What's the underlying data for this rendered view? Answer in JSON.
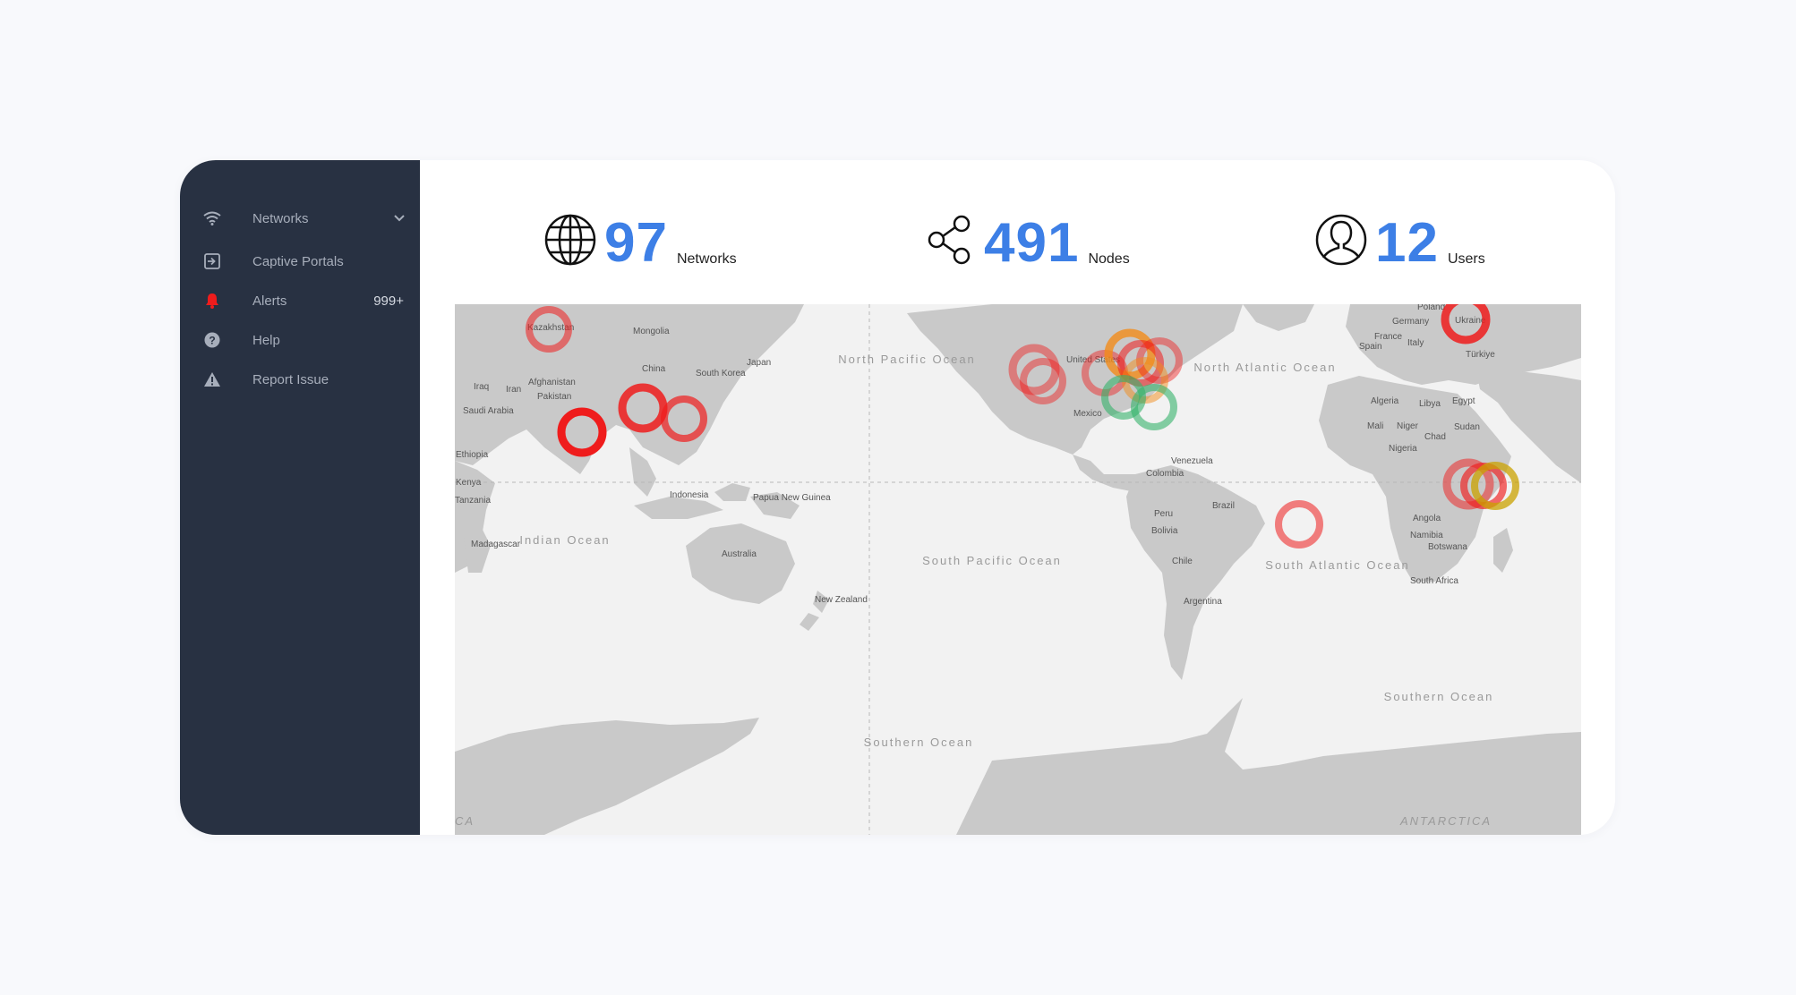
{
  "sidebar": {
    "items": [
      {
        "label": "Networks",
        "icon": "wifi-icon"
      },
      {
        "label": "Captive Portals",
        "icon": "portal-icon"
      },
      {
        "label": "Alerts",
        "icon": "bell-icon",
        "badge": "999+"
      },
      {
        "label": "Help",
        "icon": "help-icon"
      },
      {
        "label": "Report Issue",
        "icon": "warning-icon"
      }
    ]
  },
  "stats": {
    "networks": {
      "value": "97",
      "label": "Networks",
      "icon": "globe-icon"
    },
    "nodes": {
      "value": "491",
      "label": "Nodes",
      "icon": "share-icon"
    },
    "users": {
      "value": "12",
      "label": "Users",
      "icon": "user-icon"
    }
  },
  "map": {
    "country_labels": [
      "Kazakhstan",
      "Mongolia",
      "China",
      "South Korea",
      "Japan",
      "Afghanistan",
      "Iran",
      "Iraq",
      "Pakistan",
      "Saudi Arabia",
      "Ethiopia",
      "Kenya",
      "Tanzania",
      "Madagascar",
      "Indonesia",
      "Papua New Guinea",
      "Australia",
      "New Zealand",
      "United States",
      "Mexico",
      "Venezuela",
      "Colombia",
      "Peru",
      "Brazil",
      "Bolivia",
      "Chile",
      "Argentina",
      "Poland",
      "Ukraine",
      "Germany",
      "France",
      "Spain",
      "Italy",
      "Türkiye",
      "Algeria",
      "Libya",
      "Egypt",
      "Mali",
      "Niger",
      "Chad",
      "Sudan",
      "Nigeria",
      "Angola",
      "Namibia",
      "Botswana",
      "South Africa"
    ],
    "ocean_labels": [
      "Indian Ocean",
      "North Pacific Ocean",
      "South Pacific Ocean",
      "North Atlantic Ocean",
      "South Atlantic Ocean",
      "Southern Ocean",
      "Southern Ocean"
    ],
    "corner_labels": [
      "CA",
      "ANTARCTICA"
    ],
    "colors": {
      "critical": "#ef1c1c",
      "warning": "#f28c1a",
      "caution": "#c9a200",
      "ok": "#35b26b",
      "land": "#c9c9c9",
      "water": "#f2f2f2"
    }
  }
}
